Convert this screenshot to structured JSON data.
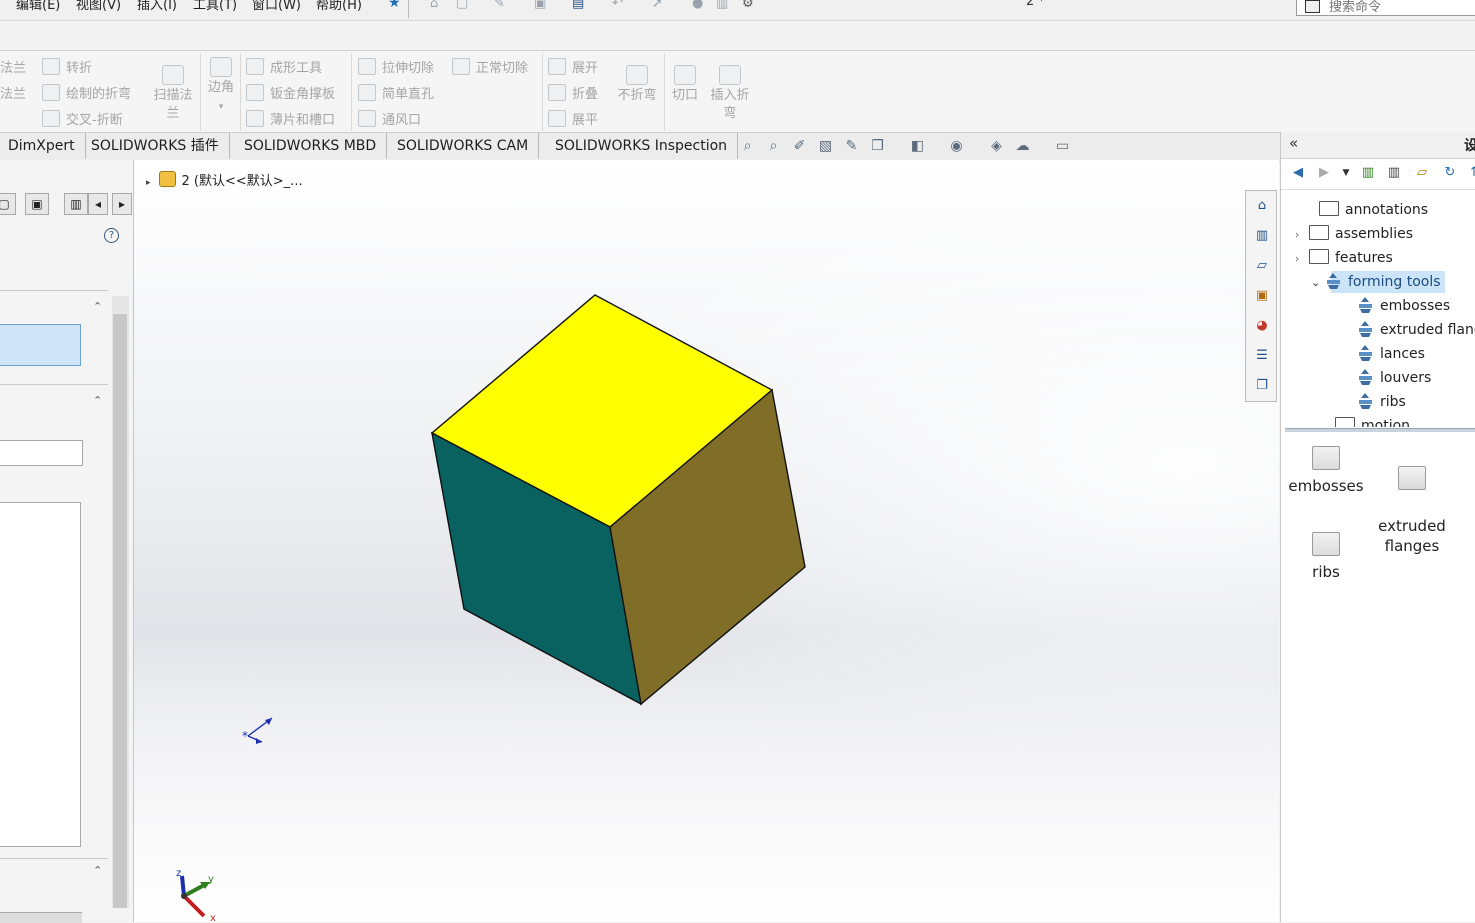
{
  "menubar": {
    "items": [
      "编辑(E)",
      "视图(V)",
      "插入(I)",
      "工具(T)",
      "窗口(W)",
      "帮助(H)"
    ],
    "doc_title": "2 *",
    "search_placeholder": "搜索命令"
  },
  "ribbon": {
    "col1": [
      "法兰",
      "法兰"
    ],
    "col2": [
      "转折",
      "绘制的折弯",
      "交叉-折断"
    ],
    "swept_flange": "扫描法兰",
    "corners": "边角",
    "col3": [
      "成形工具",
      "钣金角撑板",
      "薄片和槽口"
    ],
    "col4": [
      "拉伸切除",
      "简单直孔",
      "通风口"
    ],
    "normal_cut": "正常切除",
    "col5": [
      "展开",
      "折叠",
      "展平"
    ],
    "no_bends": "不折弯",
    "rip": "切口",
    "insert_bends": "插入折弯"
  },
  "tabs": [
    "DimXpert",
    "SOLIDWORKS 插件",
    "SOLIDWORKS MBD",
    "SOLIDWORKS CAM",
    "SOLIDWORKS Inspection"
  ],
  "viewport": {
    "tree_node": "2 (默认<<默认>_...",
    "cube_colors": {
      "top": "#ffff00",
      "left": "#0a6260",
      "right": "#7f6d28"
    },
    "triad": {
      "x": "x",
      "y": "y",
      "z": "z"
    }
  },
  "taskpane": {
    "title": "设",
    "tree": [
      {
        "label": "annotations",
        "icon": "folder-icon",
        "expander": ""
      },
      {
        "label": "assemblies",
        "icon": "folder-icon",
        "expander": "›"
      },
      {
        "label": "features",
        "icon": "folder-icon",
        "expander": "›"
      },
      {
        "label": "forming tools",
        "icon": "forming-tool-icon",
        "expander": "⌄",
        "selected": true
      },
      {
        "label": "embosses",
        "icon": "forming-tool-icon"
      },
      {
        "label": "extruded flang",
        "icon": "forming-tool-icon"
      },
      {
        "label": "lances",
        "icon": "forming-tool-icon"
      },
      {
        "label": "louvers",
        "icon": "forming-tool-icon"
      },
      {
        "label": "ribs",
        "icon": "forming-tool-icon"
      },
      {
        "label": "motion",
        "icon": "folder-icon"
      }
    ],
    "folders": [
      {
        "label": "embosses"
      },
      {
        "label": "extruded\nflanges"
      },
      {
        "label": "ribs"
      }
    ]
  }
}
